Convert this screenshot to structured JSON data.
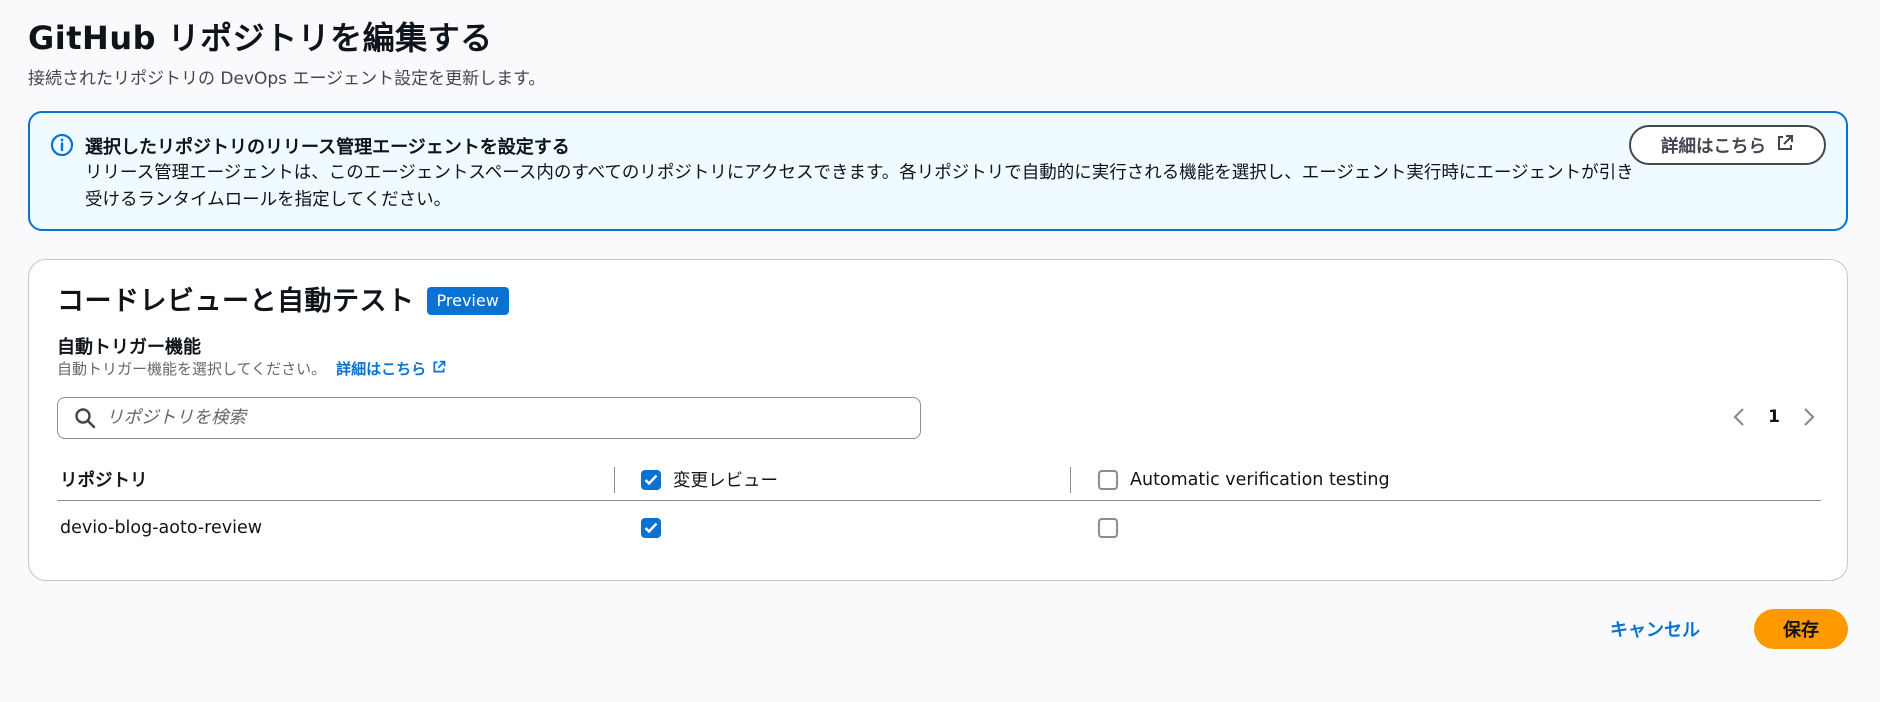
{
  "header": {
    "title": "GitHub リポジトリを編集する",
    "subtitle": "接続されたリポジトリの DevOps エージェント設定を更新します。"
  },
  "alert": {
    "icon": "info-icon",
    "title": "選択したリポジトリのリリース管理エージェントを設定する",
    "body": "リリース管理エージェントは、このエージェントスペース内のすべてのリポジトリにアクセスできます。各リポジトリで自動的に実行される機能を選択し、エージェント実行時にエージェントが引き受けるランタイムロールを指定してください。",
    "learn_more_label": "詳細はこちら"
  },
  "card": {
    "title": "コードレビューと自動テスト",
    "badge": "Preview",
    "section_label": "自動トリガー機能",
    "section_desc": "自動トリガー機能を選択してください。",
    "section_link": "詳細はこちら",
    "search": {
      "placeholder": "リポジトリを検索",
      "value": ""
    },
    "pagination": {
      "current_page": "1"
    },
    "table": {
      "columns": [
        {
          "label": "リポジトリ"
        },
        {
          "label": "変更レビュー",
          "checked": true
        },
        {
          "label": "Automatic verification testing",
          "checked": false
        }
      ],
      "rows": [
        {
          "repository": "devio-blog-aoto-review",
          "change_review": true,
          "verification_testing": false
        }
      ]
    }
  },
  "footer": {
    "cancel_label": "キャンセル",
    "save_label": "保存"
  },
  "colors": {
    "accent": "#0972d3",
    "primary_button": "#ff9900",
    "alert_background": "#f0fbff"
  }
}
